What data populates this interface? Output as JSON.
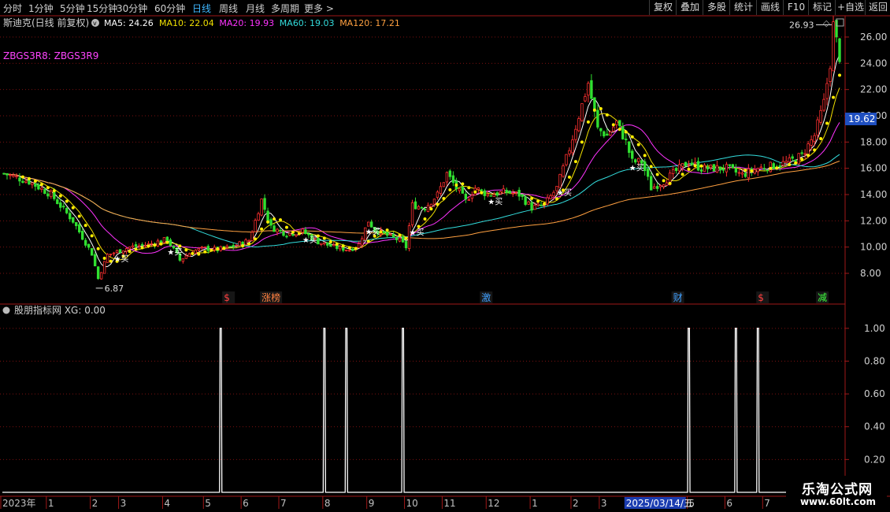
{
  "toolbar": {
    "periods": [
      {
        "label": "分时",
        "active": false
      },
      {
        "label": "1分钟",
        "active": false
      },
      {
        "label": "5分钟",
        "active": false
      },
      {
        "label": "15分钟",
        "active": false
      },
      {
        "label": "30分钟",
        "active": false
      },
      {
        "label": "60分钟",
        "active": false
      },
      {
        "label": "日线",
        "active": true
      },
      {
        "label": "周线",
        "active": false
      },
      {
        "label": "月线",
        "active": false
      },
      {
        "label": "多周期",
        "active": false
      },
      {
        "label": "更多 >",
        "active": false
      }
    ],
    "right_buttons": [
      "复权",
      "叠加",
      "多股",
      "统计",
      "画线",
      "F10",
      "标记",
      "+自选",
      "返回"
    ]
  },
  "main_panel": {
    "title": "斯迪克(日线 前复权)",
    "ma_legend": [
      {
        "label": "MA5: 24.26",
        "color": "#ffffff"
      },
      {
        "label": "MA10: 22.04",
        "color": "#f0e000"
      },
      {
        "label": "MA20: 19.93",
        "color": "#ff33ff"
      },
      {
        "label": "MA60: 19.03",
        "color": "#33dddd"
      },
      {
        "label": "MA120: 17.21",
        "color": "#ffa040"
      }
    ],
    "indicator_label": "ZBGS3R8: ZBGS3R9",
    "price_marker": "19.62",
    "high_label": "26.93",
    "low_label": "6.87",
    "buy_label": "买"
  },
  "sub_panel": {
    "title": "股朋指标网 XG: 0.00"
  },
  "events": [
    {
      "label": "$",
      "color": "#ff4040",
      "index": 70
    },
    {
      "label": "涨榜",
      "color": "#ff8040",
      "index": 82
    },
    {
      "label": "激",
      "color": "#40a0ff",
      "index": 152
    },
    {
      "label": "财",
      "color": "#40a0ff",
      "index": 213
    },
    {
      "label": "$",
      "color": "#ff4040",
      "index": 240
    },
    {
      "label": "减",
      "color": "#40ff40",
      "index": 259
    }
  ],
  "date_axis": {
    "labels": [
      {
        "label": "2023年",
        "index": 0
      },
      {
        "label": "1",
        "index": 14
      },
      {
        "label": "2",
        "index": 28
      },
      {
        "label": "3",
        "index": 37
      },
      {
        "label": "4",
        "index": 51
      },
      {
        "label": "5",
        "index": 64
      },
      {
        "label": "6",
        "index": 76
      },
      {
        "label": "7",
        "index": 88
      },
      {
        "label": "8",
        "index": 102
      },
      {
        "label": "9",
        "index": 116
      },
      {
        "label": "10",
        "index": 128
      },
      {
        "label": "11",
        "index": 140
      },
      {
        "label": "12",
        "index": 154
      },
      {
        "label": "1",
        "index": 168
      },
      {
        "label": "2",
        "index": 181
      },
      {
        "label": "3",
        "index": 190
      },
      {
        "label": "5",
        "index": 218
      },
      {
        "label": "6",
        "index": 230
      },
      {
        "label": "7",
        "index": 242
      }
    ],
    "cursor_date": "2025/03/14/五",
    "cursor_index": 198
  },
  "chart_data": [
    {
      "type": "candlestick",
      "title": "斯迪克(日线 前复权)",
      "ylim": [
        6.5,
        27.5
      ],
      "yticks": [
        8,
        10,
        12,
        14,
        16,
        18,
        20,
        22,
        24,
        26
      ],
      "grid": true,
      "series_names": [
        "MA5",
        "MA10",
        "MA20",
        "MA60",
        "MA120"
      ],
      "annotations": [
        {
          "text": "26.93",
          "type": "high",
          "index": 264,
          "value": 26.93
        },
        {
          "text": "6.87",
          "type": "low",
          "index": 29,
          "value": 6.87
        }
      ],
      "buy_signals": [
        36,
        53,
        96,
        116,
        130,
        155,
        177,
        200
      ],
      "price_keypoints": [
        [
          0,
          15.6
        ],
        [
          8,
          15.0
        ],
        [
          15,
          14.0
        ],
        [
          22,
          12.0
        ],
        [
          28,
          9.5
        ],
        [
          30,
          7.6
        ],
        [
          33,
          9.4
        ],
        [
          40,
          10.0
        ],
        [
          46,
          10.2
        ],
        [
          52,
          10.6
        ],
        [
          56,
          9.0
        ],
        [
          60,
          9.7
        ],
        [
          64,
          9.9
        ],
        [
          68,
          9.8
        ],
        [
          72,
          10.0
        ],
        [
          78,
          10.5
        ],
        [
          80,
          12.0
        ],
        [
          82,
          13.6
        ],
        [
          85,
          11.5
        ],
        [
          90,
          11.0
        ],
        [
          95,
          11.2
        ],
        [
          100,
          10.4
        ],
        [
          105,
          10.0
        ],
        [
          110,
          9.8
        ],
        [
          113,
          10.2
        ],
        [
          116,
          12.0
        ],
        [
          118,
          11.3
        ],
        [
          121,
          11.0
        ],
        [
          126,
          10.5
        ],
        [
          128,
          10.0
        ],
        [
          130,
          13.2
        ],
        [
          134,
          13.0
        ],
        [
          138,
          14.0
        ],
        [
          141,
          15.6
        ],
        [
          144,
          14.5
        ],
        [
          147,
          13.5
        ],
        [
          150,
          14.5
        ],
        [
          154,
          14.0
        ],
        [
          160,
          14.2
        ],
        [
          164,
          14.0
        ],
        [
          168,
          13.0
        ],
        [
          172,
          13.2
        ],
        [
          176,
          14.5
        ],
        [
          180,
          17.5
        ],
        [
          183,
          20.0
        ],
        [
          186,
          22.5
        ],
        [
          189,
          19.0
        ],
        [
          192,
          18.5
        ],
        [
          195,
          19.5
        ],
        [
          198,
          18.0
        ],
        [
          200,
          16.5
        ],
        [
          203,
          16.5
        ],
        [
          206,
          14.5
        ],
        [
          210,
          15.0
        ],
        [
          214,
          15.8
        ],
        [
          218,
          16.5
        ],
        [
          222,
          16.0
        ],
        [
          226,
          16.0
        ],
        [
          230,
          16.0
        ],
        [
          235,
          15.5
        ],
        [
          240,
          16.0
        ],
        [
          245,
          16.2
        ],
        [
          250,
          16.5
        ],
        [
          254,
          17.0
        ],
        [
          258,
          18.5
        ],
        [
          261,
          21.0
        ],
        [
          263,
          24.0
        ],
        [
          264,
          26.9
        ],
        [
          266,
          24.5
        ]
      ]
    },
    {
      "type": "line",
      "title": "股朋指标网 XG: 0.00",
      "ylim": [
        0,
        1.1
      ],
      "yticks": [
        0.2,
        0.4,
        0.6,
        0.8,
        1.0
      ],
      "signal_indices": [
        69,
        102,
        109,
        127,
        218,
        233,
        240
      ]
    }
  ]
}
